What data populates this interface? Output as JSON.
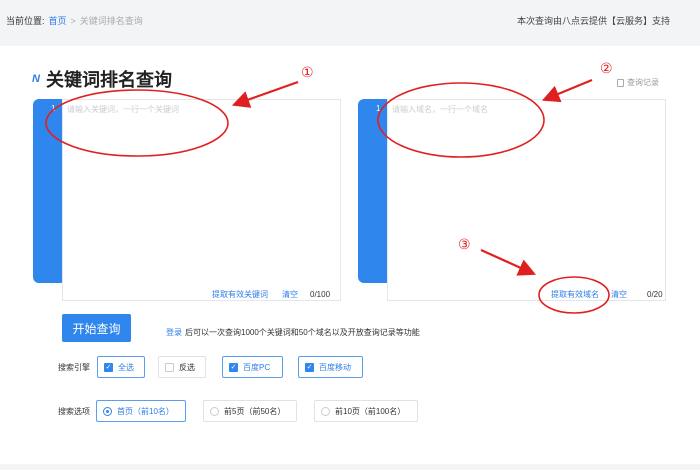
{
  "breadcrumb": {
    "prefix": "当前位置:",
    "home": "首页",
    "separator": ">",
    "current": "关键词排名查询"
  },
  "support_text": "本次查询由八点云提供【云服务】支持",
  "page_title": "关键词排名查询",
  "history_link": "查询记录",
  "keywords_box": {
    "line_number": "1",
    "placeholder": "请输入关键词，一行一个关键词",
    "extract_link": "提取有效关键词",
    "clear_link": "清空",
    "count": "0/100"
  },
  "domains_box": {
    "line_number": "1",
    "placeholder": "请输入域名，一行一个域名",
    "extract_link": "提取有效域名",
    "clear_link": "清空",
    "count": "0/20"
  },
  "start_button": "开始查询",
  "login_hint": {
    "login": "登录",
    "text": "后可以一次查询1000个关键词和50个域名以及开放查询记录等功能"
  },
  "engine_row": {
    "label": "搜索引擎",
    "options": [
      {
        "label": "全选",
        "checked": true
      },
      {
        "label": "反选",
        "checked": false
      },
      {
        "label": "百度PC",
        "checked": true
      },
      {
        "label": "百度移动",
        "checked": true
      }
    ]
  },
  "search_row": {
    "label": "搜索选项",
    "options": [
      {
        "label": "首页（前10名）",
        "selected": true
      },
      {
        "label": "前5页（前50名）",
        "selected": false
      },
      {
        "label": "前10页（前100名）",
        "selected": false
      }
    ]
  },
  "annotations": [
    "①",
    "②",
    "③"
  ],
  "colors": {
    "accent": "#2f86ec",
    "annotation": "#e02020"
  }
}
